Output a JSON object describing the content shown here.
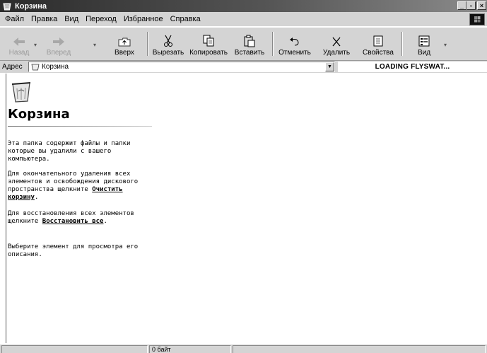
{
  "window": {
    "title": "Корзина"
  },
  "menu": [
    {
      "label": "Файл"
    },
    {
      "label": "Правка"
    },
    {
      "label": "Вид"
    },
    {
      "label": "Переход"
    },
    {
      "label": "Избранное"
    },
    {
      "label": "Справка"
    }
  ],
  "toolbar": {
    "back": "Назад",
    "forward": "Вперед",
    "up": "Вверх",
    "cut": "Вырезать",
    "copy": "Копировать",
    "paste": "Вставить",
    "undo": "Отменить",
    "delete": "Удалить",
    "properties": "Свойства",
    "view": "Вид"
  },
  "address": {
    "label": "Адрес",
    "value": "Корзина"
  },
  "flyswat": "LOADING FLYSWAT...",
  "side": {
    "title": "Корзина",
    "p1": "Эта папка содержит файлы и папки которые вы удалили с вашего компьютера.",
    "p2": "Для окончательного удаления всех элементов и освобождения дискового пространства щелкните",
    "empty_link": "Очистить корзину",
    "p3": "Для восстановления всех элементов щелкните",
    "restore_link": "Восстановить все",
    "p4": "Выберите элемент для просмотра его описания."
  },
  "status": {
    "size": "0 байт"
  },
  "icons": {
    "app": "recycle-bin-icon",
    "back": "back-arrow-icon",
    "forward": "forward-arrow-icon",
    "up": "up-folder-icon",
    "cut": "scissors-icon",
    "copy": "copy-icon",
    "paste": "paste-icon",
    "undo": "undo-icon",
    "delete": "delete-x-icon",
    "properties": "properties-icon",
    "view": "view-icon"
  }
}
